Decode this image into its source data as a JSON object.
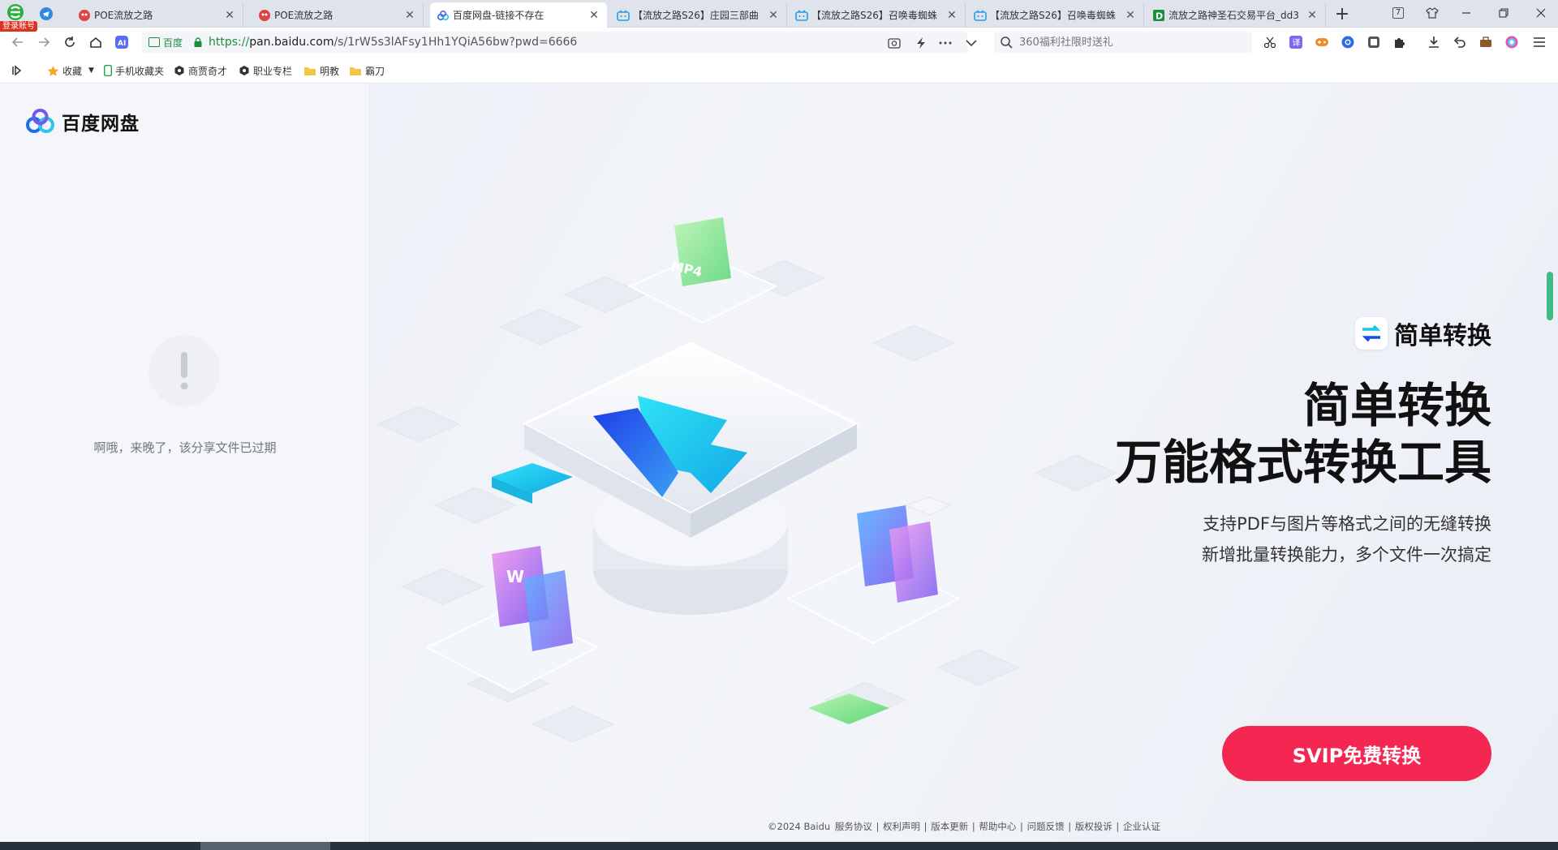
{
  "browser": {
    "account_tag": "登录账号",
    "tabs": [
      {
        "title": "POE流放之路",
        "favicon": "poe-icon",
        "active": false
      },
      {
        "title": "POE流放之路",
        "favicon": "poe-icon",
        "active": false
      },
      {
        "title": "百度网盘-链接不存在",
        "favicon": "baidu-netdisk-icon",
        "active": true
      },
      {
        "title": "【流放之路S26】庄园三部曲",
        "favicon": "bilibili-icon",
        "active": false
      },
      {
        "title": "【流放之路S26】召唤毒蜘蛛",
        "favicon": "bilibili-icon",
        "active": false
      },
      {
        "title": "【流放之路S26】召唤毒蜘蛛",
        "favicon": "bilibili-icon",
        "active": false
      },
      {
        "title": "流放之路神圣石交易平台_dd3",
        "favicon": "dd373-icon",
        "active": false
      }
    ],
    "tab_count_badge": "7",
    "address": {
      "cert_label": "百度",
      "url_scheme": "https://",
      "url_host": "pan.baidu.com",
      "url_path": "/s/1rW5s3lAFsy1Hh1YQiA56bw?pwd=6666"
    },
    "search": {
      "placeholder": "360福利社限时送礼"
    },
    "bookmarks": [
      {
        "label": "收藏",
        "icon": "star-icon"
      },
      {
        "label": "手机收藏夹",
        "icon": "phone-icon"
      },
      {
        "label": "商贾奇才",
        "icon": "hexagon-icon"
      },
      {
        "label": "职业专栏",
        "icon": "hexagon-icon"
      },
      {
        "label": "明教",
        "icon": "folder-icon"
      },
      {
        "label": "霸刀",
        "icon": "folder-icon"
      }
    ]
  },
  "page": {
    "logo_text": "百度网盘",
    "expired_message": "啊哦，来晚了，该分享文件已过期",
    "promo": {
      "badge_label": "简单转换",
      "headline_line1": "简单转换",
      "headline_line2": "万能格式转换工具",
      "sub_line1": "支持PDF与图片等格式之间的无缝转换",
      "sub_line2": "新增批量转换能力，多个文件一次搞定",
      "cta_label": "SVIP免费转换"
    },
    "footer": {
      "copyright": "©2024 Baidu",
      "links": [
        "服务协议",
        "权利声明",
        "版本更新",
        "帮助中心",
        "问题反馈",
        "版权投诉",
        "企业认证"
      ]
    }
  },
  "colors": {
    "cta": "#f42753",
    "secure_green": "#1e8e3e",
    "promo_cyan": "#16c7e8",
    "promo_blue": "#1a4de0"
  }
}
